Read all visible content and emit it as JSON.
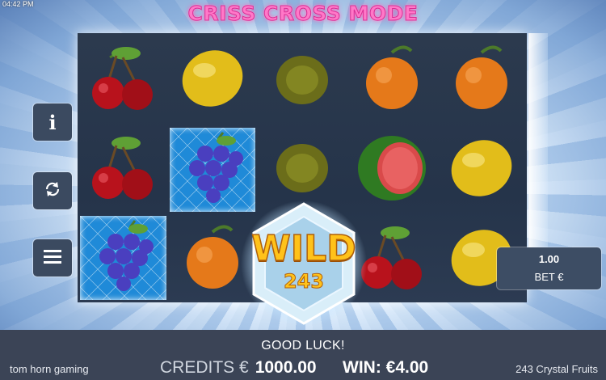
{
  "status_bar": {
    "time": "04:42 PM"
  },
  "header": {
    "title": "CRISS CROSS MODE"
  },
  "reels": {
    "grid": [
      [
        "cherry",
        "lemon",
        "kiwi",
        "orange",
        "orange"
      ],
      [
        "cherry",
        "grapes-frozen",
        "kiwi",
        "watermelon",
        "lemon"
      ],
      [
        "grapes-frozen",
        "orange",
        "wild",
        "cherry",
        "lemon"
      ]
    ],
    "wild": {
      "word": "WILD",
      "number": "243"
    }
  },
  "side_menu": {
    "info_icon": "info-icon",
    "autoplay_icon": "autoplay-icon",
    "menu_icon": "hamburger-menu-icon"
  },
  "bet": {
    "value": "1.00",
    "label": "BET €"
  },
  "footer": {
    "status_text": "GOOD LUCK!",
    "brand": "tom horn gaming",
    "game_name": "243 Crystal Fruits",
    "credits_label": "CREDITS €",
    "credits_value": "1000.00",
    "win_label": "WIN:",
    "win_value": "€4.00"
  },
  "colors": {
    "title_pink": "#ff78c8",
    "panel": "#3b4456",
    "reel_bg": "#2c3a4e",
    "wild_gold": "#ffc21a"
  }
}
